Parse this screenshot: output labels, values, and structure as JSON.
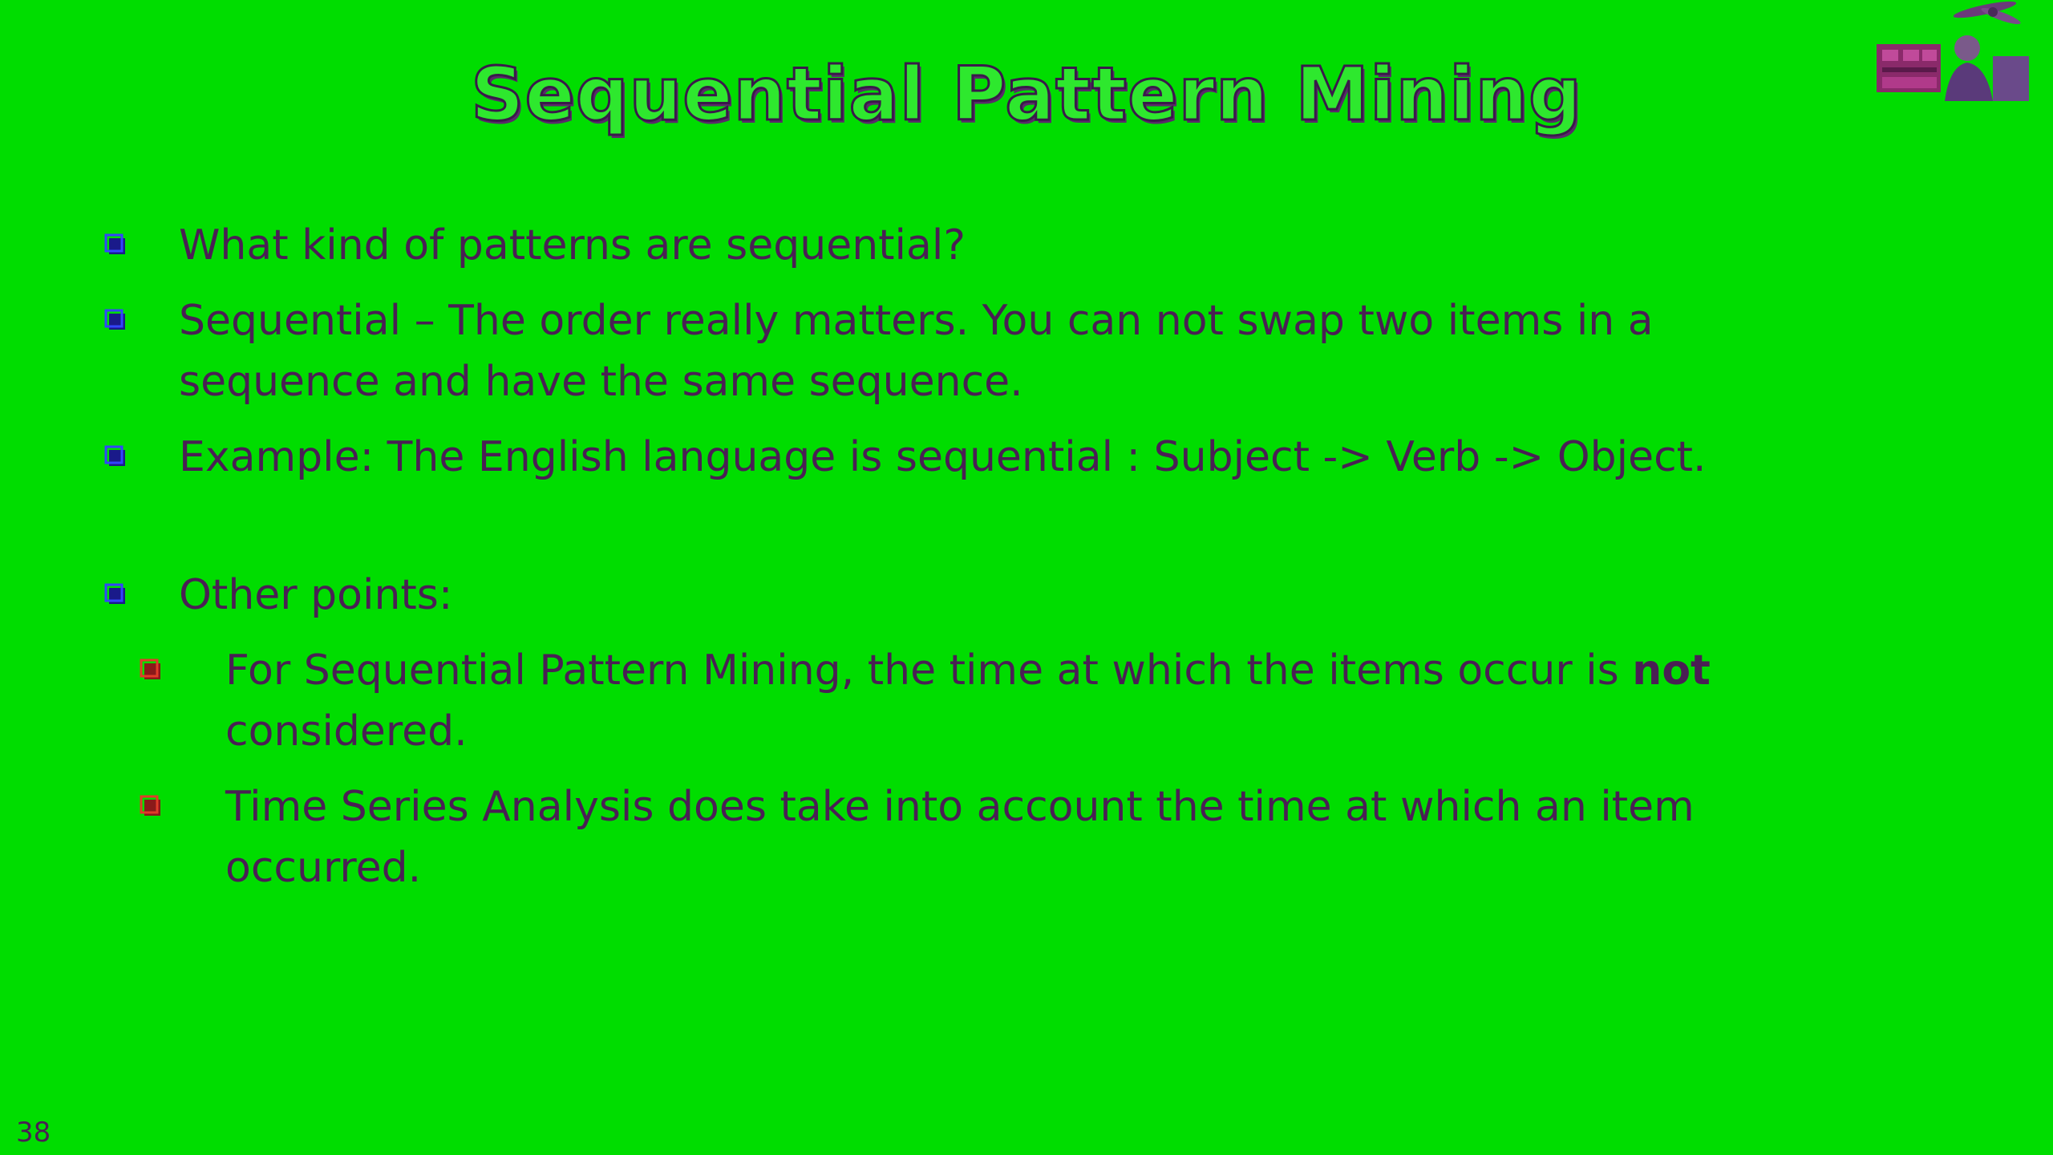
{
  "slide": {
    "title": "Sequential Pattern Mining",
    "page_number": "38"
  },
  "bullets": [
    {
      "text": "What kind of patterns are sequential?"
    },
    {
      "text": "Sequential – The order really matters.  You can not swap two items in a sequence and have the same sequence."
    },
    {
      "text": "Example: The English language is sequential : Subject -> Verb -> Object."
    },
    {
      "text": "Other points:"
    }
  ],
  "sub_bullets": [
    {
      "text_before": "For Sequential Pattern Mining, the time at which the items occur is ",
      "bold": "not",
      "text_after": " considered."
    },
    {
      "text": "Time Series Analysis does take into account the time at which an item occurred."
    }
  ],
  "colors": {
    "background": "#00dd00",
    "text": "#4a1f54",
    "bullet_main": "#3344ff",
    "bullet_sub": "#e23b2a"
  },
  "icons": {
    "main_bullet": "square-bullet-icon",
    "sub_bullet": "square-bullet-icon",
    "presenter": "presenter-webcam-thumbnail"
  }
}
